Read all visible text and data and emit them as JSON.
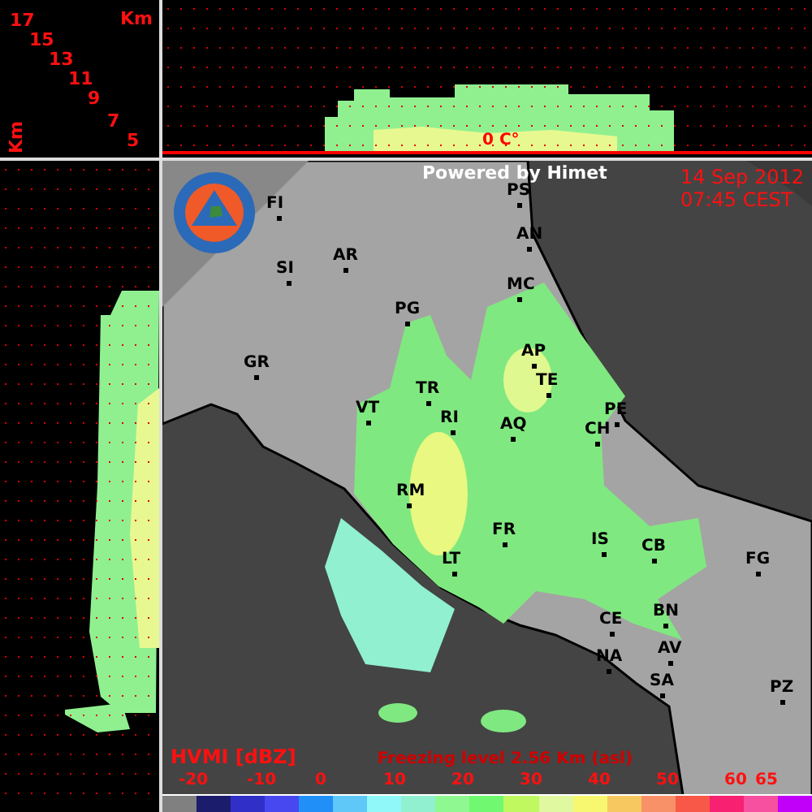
{
  "height_axis": {
    "unit_top": "Km",
    "unit_side": "Km",
    "ticks": [
      "17",
      "15",
      "13",
      "11",
      "9",
      "7",
      "5"
    ]
  },
  "top_profile": {
    "isotherm_label": "0 C°"
  },
  "header": {
    "credit": "Powered by Himet",
    "date": "14 Sep 2012",
    "time": "07:45 CEST"
  },
  "cities": [
    {
      "name": "FI"
    },
    {
      "name": "SI"
    },
    {
      "name": "AR"
    },
    {
      "name": "GR"
    },
    {
      "name": "PS"
    },
    {
      "name": "AN"
    },
    {
      "name": "MC"
    },
    {
      "name": "PG"
    },
    {
      "name": "AP"
    },
    {
      "name": "TE"
    },
    {
      "name": "TR"
    },
    {
      "name": "RI"
    },
    {
      "name": "VT"
    },
    {
      "name": "AQ"
    },
    {
      "name": "PE"
    },
    {
      "name": "CH"
    },
    {
      "name": "RM"
    },
    {
      "name": "FR"
    },
    {
      "name": "IS"
    },
    {
      "name": "CB"
    },
    {
      "name": "LT"
    },
    {
      "name": "FG"
    },
    {
      "name": "CE"
    },
    {
      "name": "BN"
    },
    {
      "name": "AV"
    },
    {
      "name": "NA"
    },
    {
      "name": "SA"
    },
    {
      "name": "PZ"
    }
  ],
  "legend": {
    "title": "HVMI [dBZ]",
    "freezing_level": "Freezing level  2.56 Km (asl)",
    "ticks": [
      "-20",
      "-10",
      "0",
      "10",
      "20",
      "30",
      "40",
      "50",
      "60",
      "65"
    ],
    "swatches": [
      {
        "color": "#808080"
      },
      {
        "color": "#1c1c6c"
      },
      {
        "color": "#3030c8"
      },
      {
        "color": "#4848f0"
      },
      {
        "color": "#2090f8"
      },
      {
        "color": "#60c8f8"
      },
      {
        "color": "#90f8f8"
      },
      {
        "color": "#90f0d0"
      },
      {
        "color": "#90f890"
      },
      {
        "color": "#70f870"
      },
      {
        "color": "#c0f860"
      },
      {
        "color": "#e0f8a0"
      },
      {
        "color": "#f8f870"
      },
      {
        "color": "#f8c860"
      },
      {
        "color": "#f89068"
      },
      {
        "color": "#f85848"
      },
      {
        "color": "#f82070"
      },
      {
        "color": "#f850a0"
      },
      {
        "color": "#c000f8"
      }
    ]
  }
}
